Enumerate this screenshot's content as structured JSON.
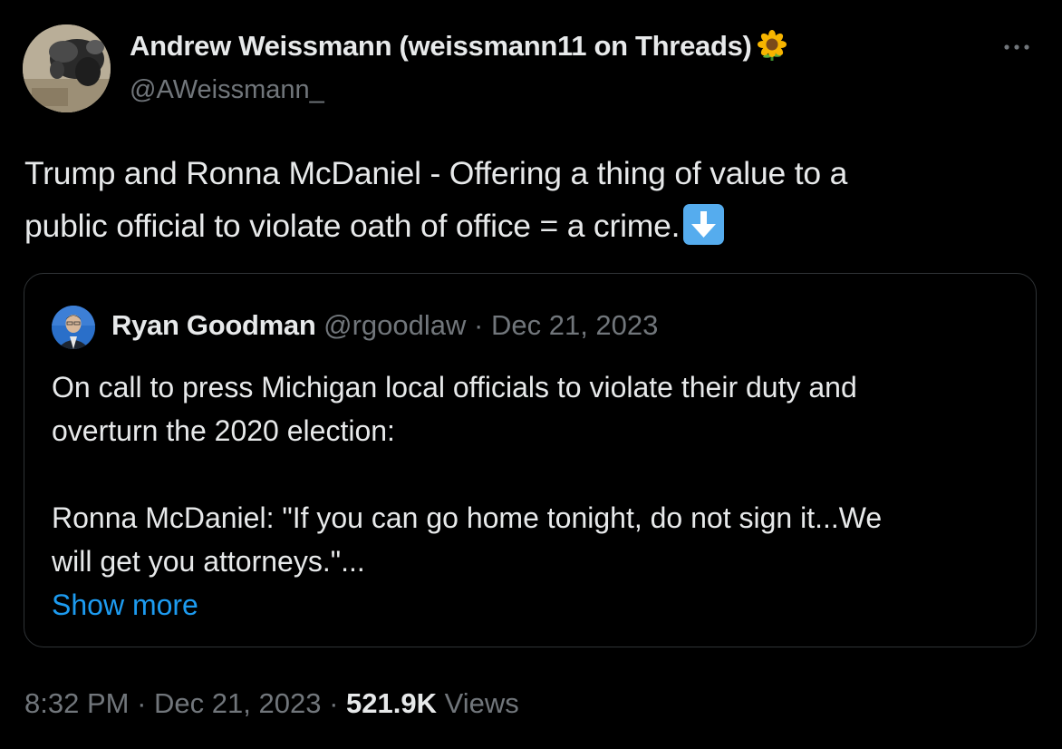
{
  "author": {
    "name": "Andrew Weissmann (weissmann11 on Threads)",
    "emoji_icon": "sunflower-icon",
    "handle": "@AWeissmann_"
  },
  "tweet": {
    "lines": [
      "Trump and Ronna McDaniel - Offering a thing of value to a",
      "public official to violate oath of office = a crime."
    ],
    "emoji_icon": "down-arrow-icon"
  },
  "quote": {
    "name": "Ryan Goodman",
    "handle": "@rgoodlaw",
    "separator": "·",
    "date": "Dec 21, 2023",
    "lines": [
      "On call to press Michigan local officials to violate their duty and",
      "overturn the 2020 election:",
      "Ronna McDaniel: \"If you can go home tonight, do not sign it...We",
      "will get you attorneys.\"..."
    ],
    "show_more": "Show more"
  },
  "meta": {
    "time": "8:32 PM",
    "separator1": "·",
    "date": "Dec 21, 2023",
    "separator2": "·",
    "views_count": "521.9K",
    "views_label": "Views"
  },
  "colors": {
    "background": "#000000",
    "text": "#e7e9ea",
    "secondary": "#71767b",
    "link": "#1d9bf0",
    "border": "#2f3336"
  }
}
